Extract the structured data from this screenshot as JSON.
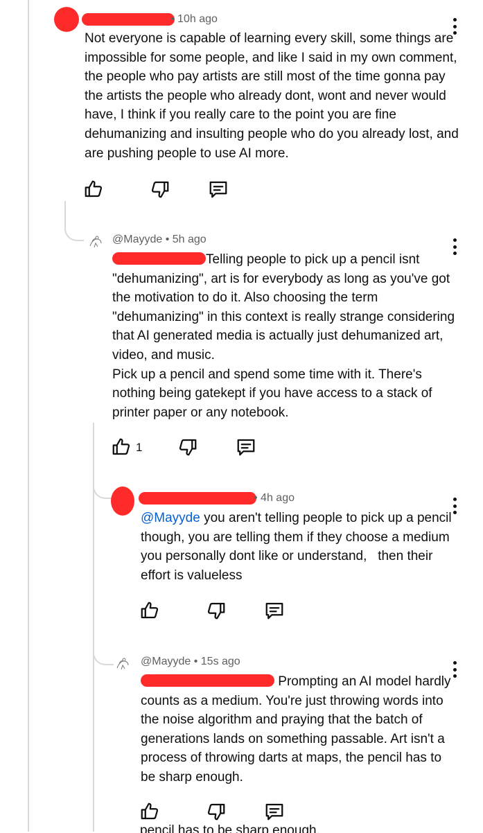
{
  "comments": [
    {
      "author_redacted": true,
      "time": "10h ago",
      "text": "Not everyone is capable of learning every skill, some things are impossible for some people, and like I said in my own comment, the people who pay artists are still most of the time gonna pay the artists the people who already dont, wont and never would have, I think if you really care to the point you are fine dehumanizing and insulting people who do you already lost, and are pushing people to use AI more.",
      "likes": ""
    },
    {
      "author": "@Mayyde",
      "time": "5h ago",
      "text": "Telling people to pick up a pencil isnt \"dehumanizing\", art is for everybody as long as you've got the motivation to do it. Also choosing the term \"dehumanizing\" in this context is really strange considering that AI generated media is actually just dehumanized art, video, and music.\nPick up a pencil and spend some time with it. There's nothing being gatekept if you have access to a stack of printer paper or any notebook.",
      "likes": "1"
    },
    {
      "author_redacted": true,
      "time": "4h ago",
      "mention": "@Mayyde",
      "text": " you aren't telling people to pick up a pencil though, you are telling them if they choose a medium you personally dont like or understand,   then their effort is valueless",
      "likes": ""
    },
    {
      "author": "@Mayyde",
      "time": "15s ago",
      "text": " Prompting an AI model hardly counts as a medium. You're just throwing words into the noise algorithm and praying that the batch of generations lands on something passable. Art isn't a process of throwing darts at maps, the pencil has to be sharp enough.",
      "likes": ""
    }
  ],
  "bottom_cutoff_text": "pencil has to be sharp enough.",
  "icons": {
    "like": "thumbs-up-icon",
    "dislike": "thumbs-down-icon",
    "reply": "reply-comment-icon",
    "more": "more-vert-icon"
  },
  "colors": {
    "redaction": "#ff2b2b",
    "mention": "#065fd4",
    "meta": "#606060",
    "thread_line": "#d9d9d9"
  }
}
